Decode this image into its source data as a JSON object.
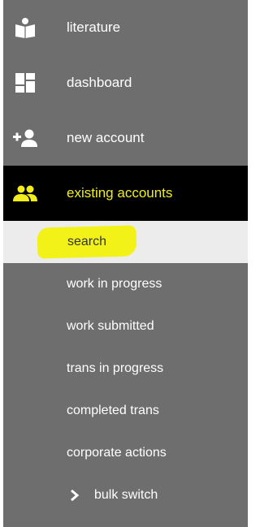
{
  "sidebar": {
    "nav": [
      {
        "label": "literature",
        "icon": "book-reader-icon"
      },
      {
        "label": "dashboard",
        "icon": "dashboard-icon"
      },
      {
        "label": "new account",
        "icon": "add-user-icon"
      },
      {
        "label": "existing accounts",
        "icon": "users-icon",
        "active": true
      }
    ],
    "sub": [
      {
        "label": "search",
        "selected": true,
        "annotation": "yellow-highlighter-mark"
      },
      {
        "label": "work in progress"
      },
      {
        "label": "work submitted"
      },
      {
        "label": "trans in progress"
      },
      {
        "label": "completed trans"
      },
      {
        "label": "corporate actions"
      },
      {
        "label": "bulk switch",
        "icon": "chevron-right-icon"
      }
    ]
  },
  "colors": {
    "sidebar_bg": "#6e6e6e",
    "active_bg": "#000000",
    "active_accent": "#f2ee1e",
    "selected_bg": "#ececec",
    "highlighter": "#f2f218"
  }
}
